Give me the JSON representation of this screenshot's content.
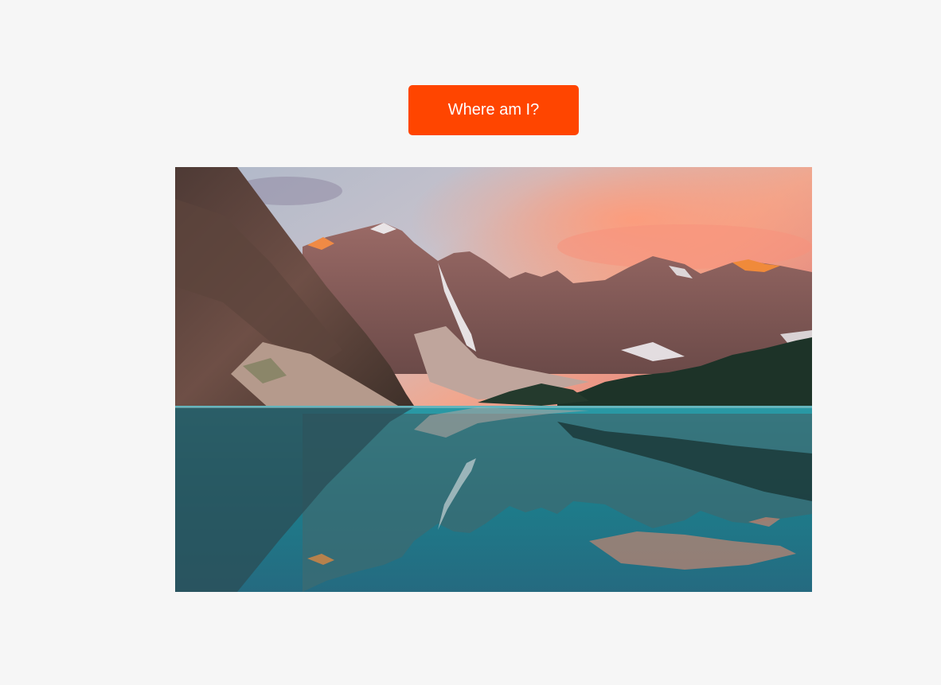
{
  "button": {
    "label": "Where am I?",
    "color": "#ff4500"
  },
  "photo": {
    "subject": "mountain-lake-landscape",
    "palette": {
      "sky_top": "#b9c2cf",
      "sky_glow": "#f2a387",
      "peak_alpenglow": "#f08a3a",
      "rock": "#8a5f5b",
      "forest": "#1d3328",
      "lake": "#1f8896"
    }
  }
}
